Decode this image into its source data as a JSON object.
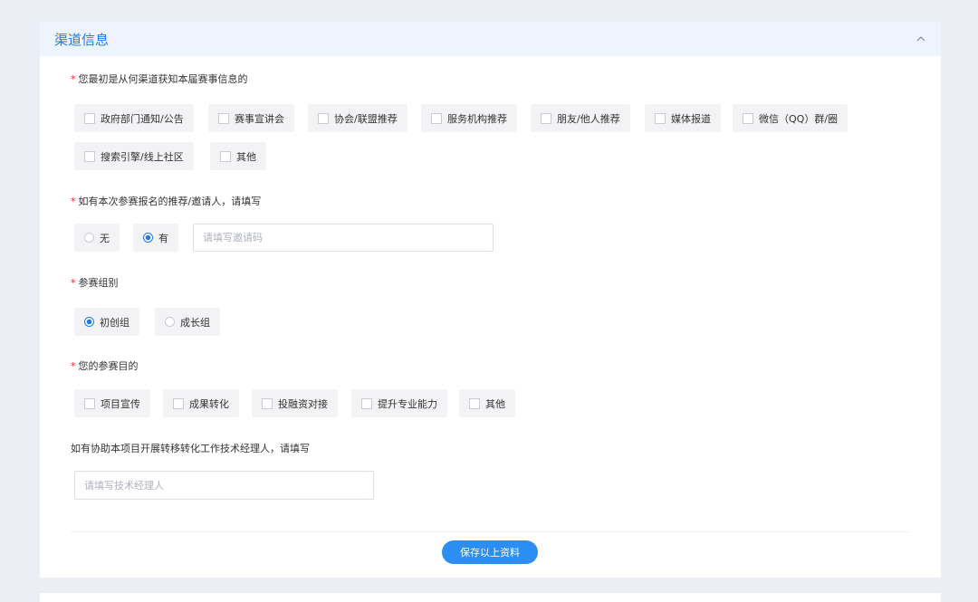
{
  "section": {
    "title": "渠道信息",
    "collapse_icon": "chevron-up-icon"
  },
  "q1": {
    "label": "您最初是从何渠道获知本届赛事信息的",
    "required": "*",
    "options": [
      "政府部门通知/公告",
      "赛事宣讲会",
      "协会/联盟推荐",
      "服务机构推荐",
      "朋友/他人推荐",
      "媒体报道",
      "微信（QQ）群/圈",
      "搜索引擎/线上社区",
      "其他"
    ]
  },
  "q2": {
    "label": "如有本次参赛报名的推荐/邀请人，请填写",
    "required": "*",
    "options": [
      "无",
      "有"
    ],
    "selected": "有",
    "input_placeholder": "请填写邀请码"
  },
  "q3": {
    "label": "参赛组别",
    "required": "*",
    "options": [
      "初创组",
      "成长组"
    ],
    "selected": "初创组"
  },
  "q4": {
    "label": "您的参赛目的",
    "required": "*",
    "options": [
      "项目宣传",
      "成果转化",
      "投融资对接",
      "提升专业能力",
      "其他"
    ]
  },
  "q5": {
    "label": "如有协助本项目开展转移转化工作技术经理人，请填写",
    "input_placeholder": "请填写技术经理人"
  },
  "save_button": "保存以上资料",
  "colors": {
    "accent": "#1f7be8",
    "button": "#2b8ef0",
    "header_bg": "#edf4fd",
    "required": "#f5222d",
    "page_bg": "#eceef5"
  }
}
